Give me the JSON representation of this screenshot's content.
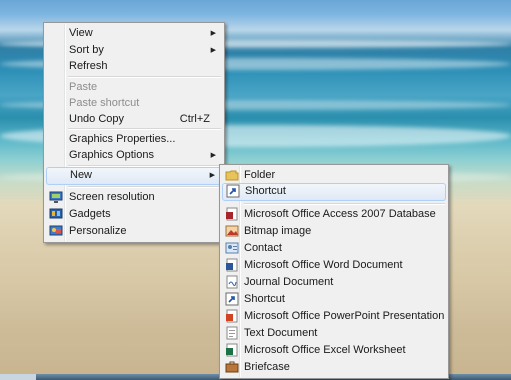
{
  "main_menu": {
    "items": [
      {
        "label": "View",
        "submenu": true
      },
      {
        "label": "Sort by",
        "submenu": true
      },
      {
        "label": "Refresh"
      },
      {
        "label": "Paste",
        "disabled": true
      },
      {
        "label": "Paste shortcut",
        "disabled": true
      },
      {
        "label": "Undo Copy",
        "shortcut": "Ctrl+Z"
      },
      {
        "label": "Graphics Properties..."
      },
      {
        "label": "Graphics Options",
        "submenu": true
      },
      {
        "label": "New",
        "submenu": true,
        "highlighted": true
      },
      {
        "label": "Screen resolution",
        "icon": "screen-resolution-icon"
      },
      {
        "label": "Gadgets",
        "icon": "gadgets-icon"
      },
      {
        "label": "Personalize",
        "icon": "personalize-icon"
      }
    ]
  },
  "new_submenu": {
    "items": [
      {
        "label": "Folder",
        "icon": "folder-icon"
      },
      {
        "label": "Shortcut",
        "icon": "shortcut-icon",
        "highlighted": true
      },
      {
        "label": "Microsoft Office Access 2007 Database",
        "icon": "access-database-icon"
      },
      {
        "label": "Bitmap image",
        "icon": "bitmap-image-icon"
      },
      {
        "label": "Contact",
        "icon": "contact-icon"
      },
      {
        "label": "Microsoft Office Word Document",
        "icon": "word-document-icon"
      },
      {
        "label": "Journal Document",
        "icon": "journal-document-icon"
      },
      {
        "label": "Shortcut",
        "icon": "shortcut-icon"
      },
      {
        "label": "Microsoft Office PowerPoint Presentation",
        "icon": "powerpoint-presentation-icon"
      },
      {
        "label": "Text Document",
        "icon": "text-document-icon"
      },
      {
        "label": "Microsoft Office Excel Worksheet",
        "icon": "excel-worksheet-icon"
      },
      {
        "label": "Briefcase",
        "icon": "briefcase-icon"
      }
    ]
  },
  "colors": {
    "menu_background": "#f0f0f0",
    "menu_border": "#979797",
    "highlight_border": "#aecff7",
    "disabled_text": "#8d8d8d"
  }
}
